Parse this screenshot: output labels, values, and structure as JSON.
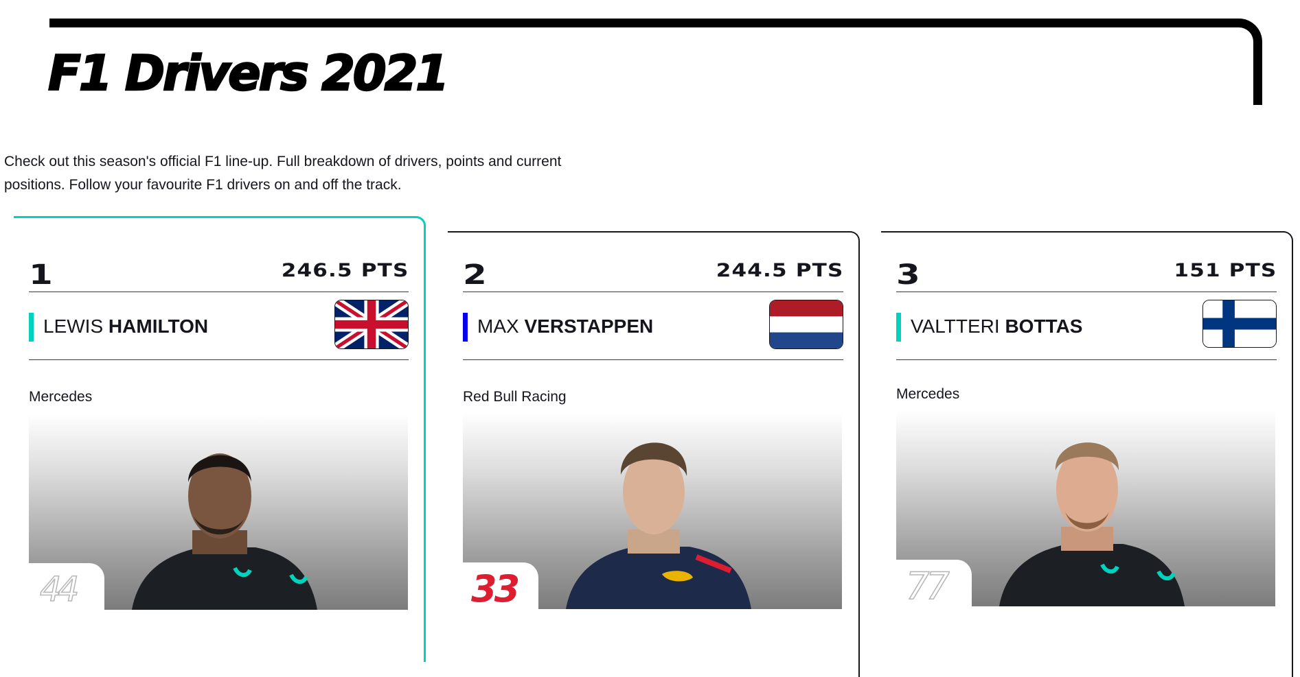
{
  "page": {
    "title": "F1 Drivers 2021",
    "intro": "Check out this season's official F1 line-up. Full breakdown of drivers, points and current positions. Follow your favourite F1 drivers on and off the track."
  },
  "drivers": [
    {
      "rank": "1",
      "points": "246.5 PTS",
      "first_name": "LEWIS",
      "last_name": "HAMILTON",
      "team": "Mercedes",
      "team_color": "#00d2be",
      "flag_icon": "uk-flag-icon",
      "number": "44",
      "number_color": "#b8b8b8",
      "active": true
    },
    {
      "rank": "2",
      "points": "244.5 PTS",
      "first_name": "MAX",
      "last_name": "VERSTAPPEN",
      "team": "Red Bull Racing",
      "team_color": "#0600ef",
      "flag_icon": "netherlands-flag-icon",
      "number": "33",
      "number_color": "#dc1e30",
      "active": false
    },
    {
      "rank": "3",
      "points": "151 PTS",
      "first_name": "VALTTERI",
      "last_name": "BOTTAS",
      "team": "Mercedes",
      "team_color": "#00d2be",
      "flag_icon": "finland-flag-icon",
      "number": "77",
      "number_color": "#b8b8b8",
      "active": false
    }
  ]
}
